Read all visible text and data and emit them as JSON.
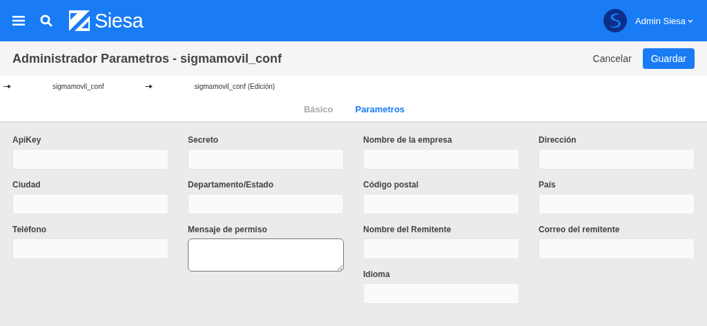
{
  "topbar": {
    "brand": "Siesa",
    "user": "Admin Siesa"
  },
  "page_header": {
    "title": "Administrador Parametros - sigmamovil_conf",
    "buttons": [
      {
        "label": "Cancelar",
        "kind": "link"
      },
      {
        "label": "Guardar",
        "kind": "primary"
      }
    ]
  },
  "breadcrumbs": [
    "sigmamovil_conf",
    "sigmamovil_conf (Edición)"
  ],
  "tabs": [
    {
      "label": "Básico",
      "selected": false
    },
    {
      "label": "Parametros",
      "selected": true
    }
  ],
  "form_columns": [
    {
      "fields": [
        {
          "label": "ApiKey",
          "kind": "input"
        },
        {
          "label": "Ciudad",
          "kind": "input"
        },
        {
          "label": "Teléfono",
          "kind": "input"
        }
      ]
    },
    {
      "fields": [
        {
          "label": "Secreto",
          "kind": "input"
        },
        {
          "label": "Departamento/Estado",
          "kind": "input"
        },
        {
          "label": "Mensaje de permiso",
          "kind": "textarea"
        }
      ]
    },
    {
      "fields": [
        {
          "label": "Nombre de la empresa",
          "kind": "input"
        },
        {
          "label": "Código postal",
          "kind": "input"
        },
        {
          "label": "Nombre del Remitente",
          "kind": "input"
        },
        {
          "label": "Idioma",
          "kind": "input"
        }
      ]
    },
    {
      "fields": [
        {
          "label": "Dirección",
          "kind": "input"
        },
        {
          "label": "País",
          "kind": "input"
        },
        {
          "label": "Correo del remitente",
          "kind": "input"
        }
      ]
    }
  ]
}
